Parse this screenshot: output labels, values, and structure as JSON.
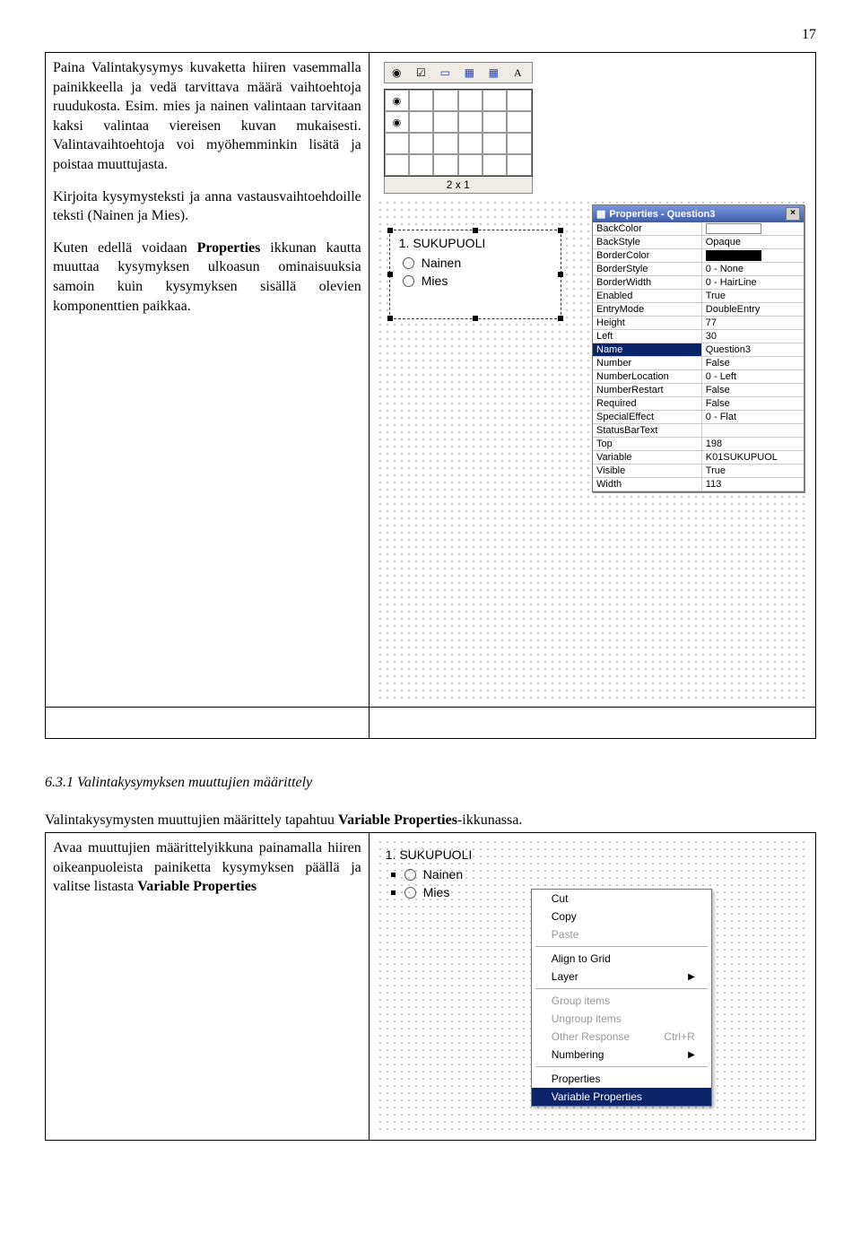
{
  "page_number": "17",
  "para1": "Paina Valintakysymys kuvaketta hiiren vasemmalla painikkeella ja vedä tarvittava määrä vaihtoehtoja ruudukosta. Esim. mies ja nainen valintaan tarvitaan kaksi valintaa viereisen kuvan mukaisesti. Valintavaihtoehtoja voi myöhemminkin lisätä ja poistaa muuttujasta.",
  "para2": "Kirjoita kysymysteksti ja anna vastausvaihtoehdoille teksti (Nainen ja Mies).",
  "para3_a": "Kuten edellä voidaan ",
  "para3_b": "Properties",
  "para3_c": " ikkunan kautta muuttaa kysymyksen ulkoasun ominaisuuksia samoin kuin kysymyksen sisällä olevien komponenttien paikkaa.",
  "toolbox": {
    "dim_label": "2 x 1"
  },
  "question": {
    "title": "1. SUKUPUOLI",
    "opt1": "Nainen",
    "opt2": "Mies"
  },
  "props_title": "Properties - Question3",
  "properties": [
    {
      "name": "BackColor",
      "value": "",
      "swatch": "white"
    },
    {
      "name": "BackStyle",
      "value": "Opaque"
    },
    {
      "name": "BorderColor",
      "value": "",
      "swatch": "black"
    },
    {
      "name": "BorderStyle",
      "value": "0 - None"
    },
    {
      "name": "BorderWidth",
      "value": "0 - HairLine"
    },
    {
      "name": "Enabled",
      "value": "True"
    },
    {
      "name": "EntryMode",
      "value": "DoubleEntry"
    },
    {
      "name": "Height",
      "value": "77"
    },
    {
      "name": "Left",
      "value": "30"
    },
    {
      "name": "Name",
      "value": "Question3",
      "selected": true
    },
    {
      "name": "Number",
      "value": "False"
    },
    {
      "name": "NumberLocation",
      "value": "0 - Left"
    },
    {
      "name": "NumberRestart",
      "value": "False"
    },
    {
      "name": "Required",
      "value": "False"
    },
    {
      "name": "SpecialEffect",
      "value": "0 - Flat"
    },
    {
      "name": "StatusBarText",
      "value": ""
    },
    {
      "name": "Top",
      "value": "198"
    },
    {
      "name": "Variable",
      "value": "K01SUKUPUOL"
    },
    {
      "name": "Visible",
      "value": "True"
    },
    {
      "name": "Width",
      "value": "113"
    }
  ],
  "section_heading": "6.3.1 Valintakysymyksen muuttujien määrittely",
  "body2_a": "Valintakysymysten muuttujien määrittely tapahtuu ",
  "body2_b": "Variable Properties",
  "body2_c": "-ikkunassa.",
  "fig2_left_a": "Avaa muuttujien määrittelyikkuna painamalla hiiren oikeanpuoleista painiketta kysymyksen päällä ja valitse listasta ",
  "fig2_left_b": "Variable Properties",
  "context_menu": {
    "cut": "Cut",
    "copy": "Copy",
    "paste": "Paste",
    "align": "Align to Grid",
    "layer": "Layer",
    "group": "Group items",
    "ungroup": "Ungroup items",
    "other": "Other Response",
    "other_hint": "Ctrl+R",
    "numbering": "Numbering",
    "properties": "Properties",
    "varprops": "Variable Properties"
  }
}
